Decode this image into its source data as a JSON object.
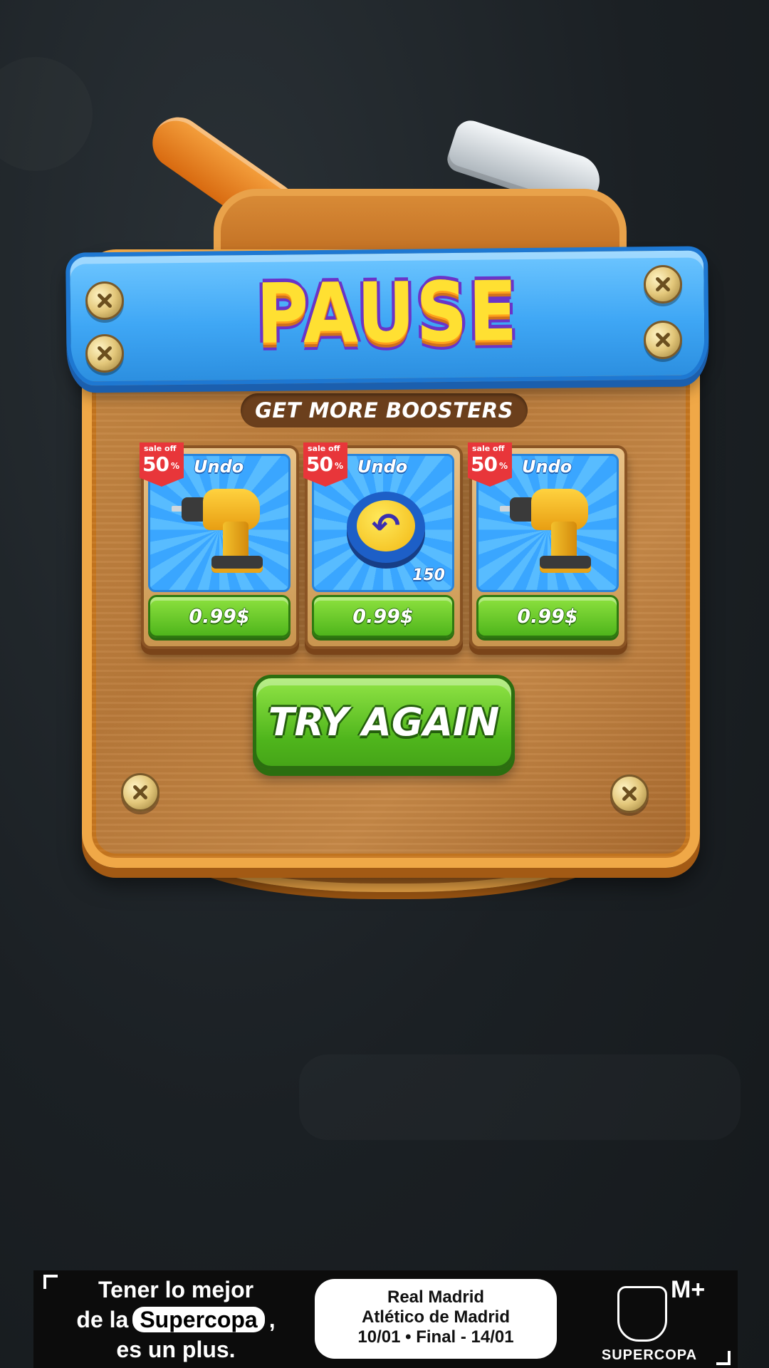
{
  "dialog": {
    "title": "PAUSE",
    "subtitle": "GET MORE BOOSTERS",
    "primary_button": "TRY AGAIN"
  },
  "boosters": [
    {
      "badge_label": "sale off",
      "badge_value": "50",
      "badge_symbol": "%",
      "name": "Undo",
      "icon": "drill-icon",
      "price": "0.99$",
      "quantity": ""
    },
    {
      "badge_label": "sale off",
      "badge_value": "50",
      "badge_symbol": "%",
      "name": "Undo",
      "icon": "undo-icon",
      "price": "0.99$",
      "quantity": "150"
    },
    {
      "badge_label": "sale off",
      "badge_value": "50",
      "badge_symbol": "%",
      "name": "Undo",
      "icon": "drill-icon",
      "price": "0.99$",
      "quantity": ""
    }
  ],
  "ad": {
    "line1": "Tener lo mejor",
    "line2_prefix": "de la",
    "line2_chip": "Supercopa",
    "line2_suffix": ",",
    "line3": "es un plus.",
    "match_team1": "Real Madrid",
    "match_team2": "Atlético de Madrid",
    "match_dates": "10/01  •  Final - 14/01",
    "logo_text": "SUPERCOPA",
    "brand": "M+"
  },
  "colors": {
    "banner": "#3fa7f5",
    "title": "#ffe032",
    "panel_border": "#f0a847",
    "button_green": "#4fb51c",
    "sale_red": "#e8363a"
  }
}
